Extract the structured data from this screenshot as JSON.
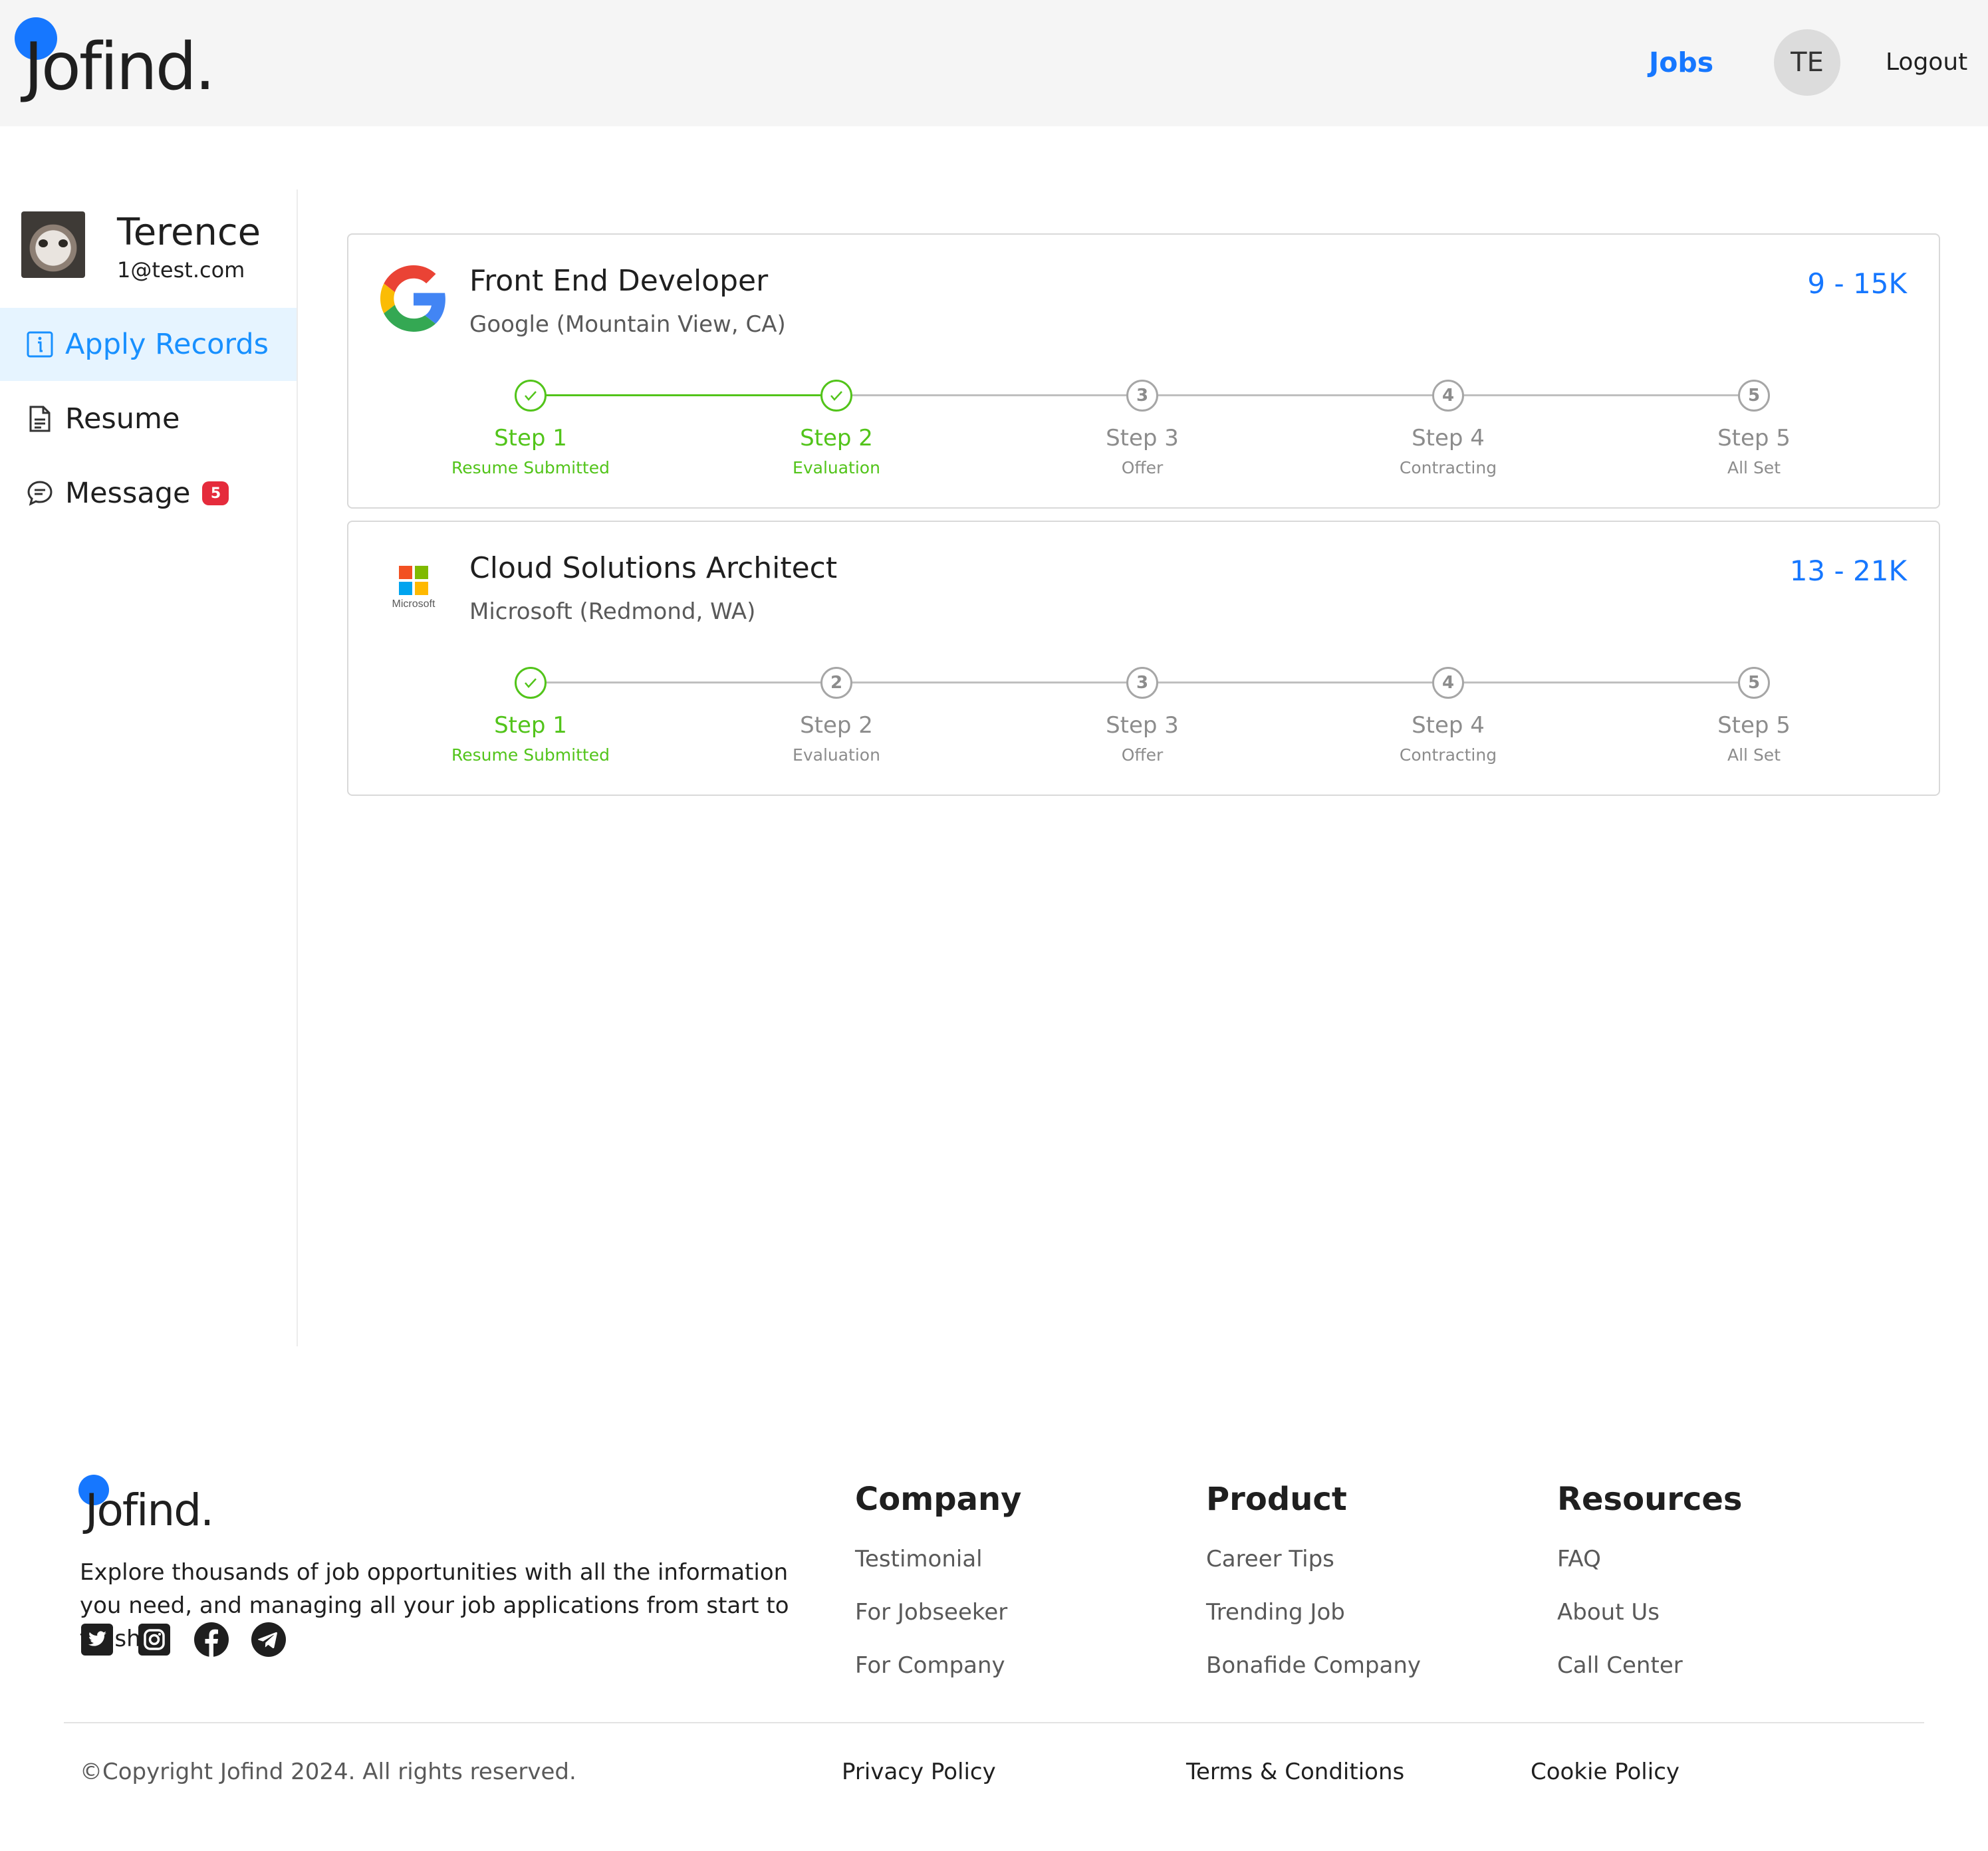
{
  "header": {
    "logo_text": "Jofind.",
    "nav_jobs": "Jobs",
    "avatar_initials": "TE",
    "logout": "Logout"
  },
  "sidebar": {
    "user_name": "Terence",
    "user_email": "1@test.com",
    "menu": [
      {
        "label": "Apply Records",
        "icon": "info-icon",
        "active": true
      },
      {
        "label": "Resume",
        "icon": "document-icon",
        "active": false
      },
      {
        "label": "Message",
        "icon": "chat-icon",
        "active": false,
        "badge": "5"
      }
    ]
  },
  "applications": [
    {
      "title": "Front End Developer",
      "company": "Google (Mountain View, CA)",
      "salary": "9 - 15K",
      "logo": "google-logo",
      "current_step": 2,
      "steps": [
        {
          "title": "Step 1",
          "desc": "Resume Submitted",
          "status": "finished"
        },
        {
          "title": "Step 2",
          "desc": "Evaluation",
          "status": "finished"
        },
        {
          "title": "Step 3",
          "desc": "Offer",
          "status": "waiting"
        },
        {
          "title": "Step 4",
          "desc": "Contracting",
          "status": "waiting"
        },
        {
          "title": "Step 5",
          "desc": "All Set",
          "status": "waiting"
        }
      ]
    },
    {
      "title": "Cloud Solutions Architect",
      "company": "Microsoft (Redmond, WA)",
      "salary": "13 - 21K",
      "logo": "microsoft-logo",
      "logo_caption": "Microsoft",
      "current_step": 1,
      "steps": [
        {
          "title": "Step 1",
          "desc": "Resume Submitted",
          "status": "finished"
        },
        {
          "title": "Step 2",
          "desc": "Evaluation",
          "status": "waiting"
        },
        {
          "title": "Step 3",
          "desc": "Offer",
          "status": "waiting"
        },
        {
          "title": "Step 4",
          "desc": "Contracting",
          "status": "waiting"
        },
        {
          "title": "Step 5",
          "desc": "All Set",
          "status": "waiting"
        }
      ]
    }
  ],
  "footer": {
    "logo_text": "Jofind.",
    "description": "Explore thousands of job opportunities with all the information you need, and managing all your job applications from start to finish.",
    "socials": [
      "twitter-icon",
      "instagram-icon",
      "facebook-icon",
      "telegram-icon"
    ],
    "columns": [
      {
        "heading": "Company",
        "links": [
          "Testimonial",
          "For Jobseeker",
          "For Company"
        ]
      },
      {
        "heading": "Product",
        "links": [
          "Career Tips",
          "Trending Job",
          "Bonafide Company"
        ]
      },
      {
        "heading": "Resources",
        "links": [
          "FAQ",
          "About Us",
          "Call Center"
        ]
      }
    ],
    "copyright": "©Copyright Jofind 2024. All rights reserved.",
    "legal_links": [
      "Privacy Policy",
      "Terms & Conditions",
      "Cookie Policy"
    ]
  },
  "colors": {
    "primary": "#1677ff",
    "success": "#52c41a",
    "muted": "#8c8c8c",
    "badge": "#e52b3c",
    "header_bg": "#f5f5f5",
    "active_menu_bg": "#e6f4ff"
  }
}
